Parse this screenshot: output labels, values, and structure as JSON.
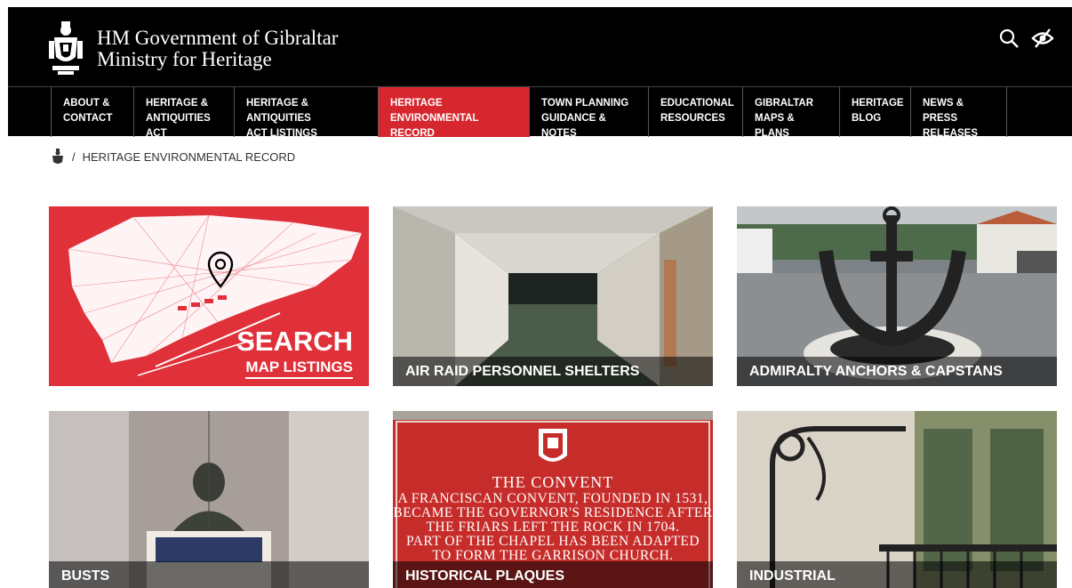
{
  "header": {
    "title_line1": "HM Government of Gibraltar",
    "title_line2": "Ministry for Heritage",
    "icons": [
      "crest-icon",
      "search-icon",
      "accessibility-eye-icon"
    ]
  },
  "nav": {
    "items": [
      {
        "label": "ABOUT &\nCONTACT"
      },
      {
        "label": "HERITAGE &\nANTIQUITIES ACT"
      },
      {
        "label": "HERITAGE & ANTIQUITIES\nACT LISTINGS"
      },
      {
        "label": "HERITAGE\nENVIRONMENTAL RECORD"
      },
      {
        "label": "TOWN PLANNING\nGUIDANCE & NOTES"
      },
      {
        "label": "EDUCATIONAL\nRESOURCES"
      },
      {
        "label": "GIBRALTAR\nMAPS & PLANS"
      },
      {
        "label": "HERITAGE\nBLOG"
      },
      {
        "label": "NEWS & PRESS\nRELEASES"
      }
    ],
    "active_color": "#d6272f"
  },
  "breadcrumb": {
    "separator": "/",
    "current": "HERITAGE ENVIRONMENTAL RECORD"
  },
  "tiles": {
    "search": {
      "big": "SEARCH",
      "small": "MAP LISTINGS"
    },
    "shelters": {
      "label": "AIR RAID PERSONNEL SHELTERS"
    },
    "anchors": {
      "label": "ADMIRALTY ANCHORS & CAPSTANS"
    },
    "busts": {
      "label": "BUSTS"
    },
    "plaques": {
      "label": "HISTORICAL PLAQUES",
      "plaque_title": "THE CONVENT",
      "plaque_lines": [
        "A FRANCISCAN CONVENT, FOUNDED IN 1531,",
        "BECAME THE GOVERNOR'S RESIDENCE AFTER",
        "THE FRIARS LEFT THE ROCK IN 1704.",
        "PART OF THE CHAPEL HAS BEEN ADAPTED",
        "TO FORM THE GARRISON CHURCH."
      ]
    },
    "industrial": {
      "label": "INDUSTRIAL"
    }
  }
}
